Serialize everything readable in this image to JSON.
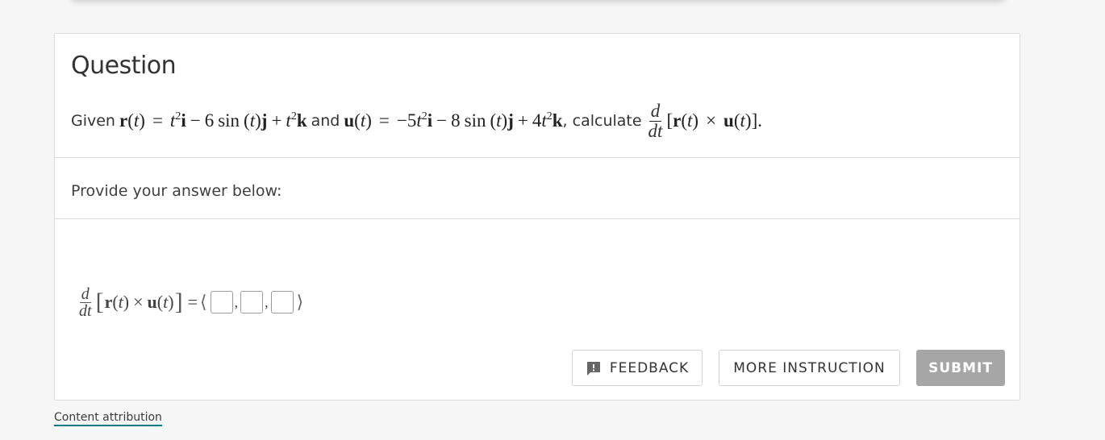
{
  "question": {
    "title": "Question",
    "intro": "Given",
    "r_name": "r",
    "t_var": "t",
    "r_def": {
      "term1": "t",
      "exp1": "2",
      "unit1": "i",
      "op1": "−",
      "coef2": "6",
      "func": "sin",
      "unit2": "j",
      "op2": "+",
      "term3": "t",
      "exp3": "2",
      "unit3": "k"
    },
    "connector": "and",
    "u_name": "u",
    "u_def": {
      "sign1": "−5",
      "term1": "t",
      "exp1": "2",
      "unit1": "i",
      "op1": "−",
      "coef2": "8",
      "func": "sin",
      "unit2": "j",
      "op2": "+",
      "coef3": "4",
      "term3": "t",
      "exp3": "2",
      "unit3": "k"
    },
    "calc_text": ", calculate",
    "deriv_num": "d",
    "deriv_den": "dt",
    "cross": "×",
    "equals": "="
  },
  "prompt": {
    "text": "Provide your answer below:"
  },
  "answer": {
    "deriv_num": "d",
    "deriv_den": "dt",
    "r_name": "r",
    "u_name": "u",
    "t_var": "t",
    "cross": "×",
    "equals": "=",
    "open_angle": "⟨",
    "close_angle": "⟩",
    "separator": ",",
    "inputs": [
      {
        "value": "",
        "placeholder": ""
      },
      {
        "value": "",
        "placeholder": ""
      },
      {
        "value": "",
        "placeholder": ""
      }
    ]
  },
  "buttons": {
    "feedback": {
      "label": "FEEDBACK",
      "icon": "feedback-icon"
    },
    "more_instruction": {
      "label": "MORE INSTRUCTION"
    },
    "submit": {
      "label": "SUBMIT",
      "state": "disabled"
    }
  },
  "footer": {
    "attribution_label": "Content attribution"
  },
  "colors": {
    "accent_underline": "#00798a",
    "submit_disabled": "#a6a6a6"
  }
}
